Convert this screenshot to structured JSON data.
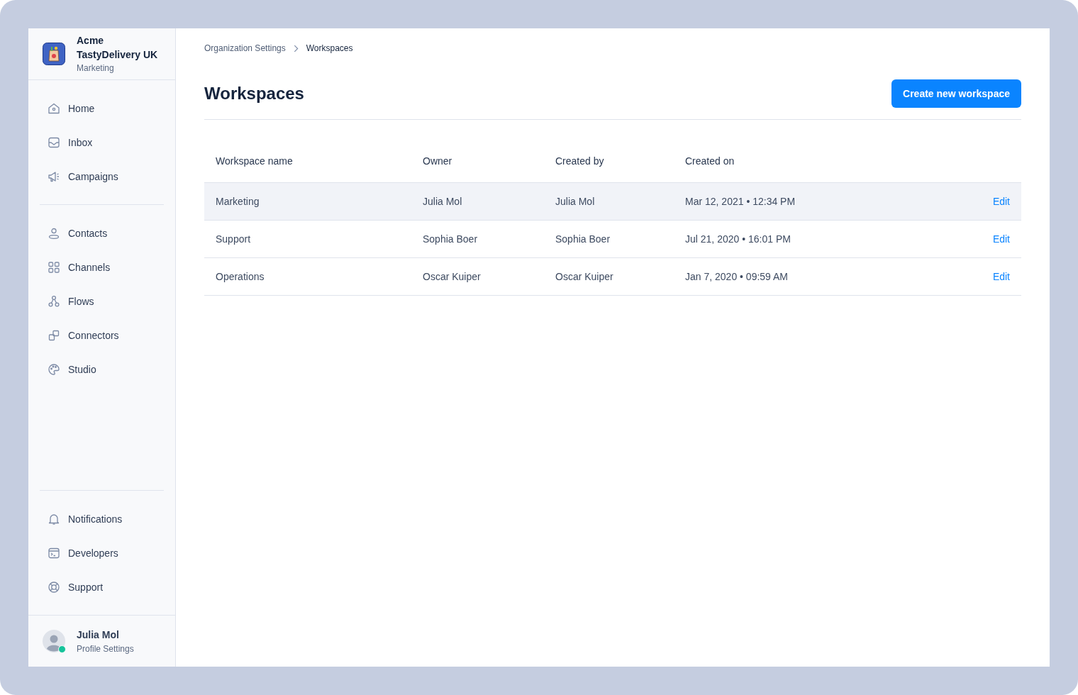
{
  "org": {
    "company": "Acme",
    "name": "TastyDelivery UK",
    "workspace": "Marketing"
  },
  "nav_groups": [
    {
      "items": [
        {
          "label": "Home",
          "selected": false
        },
        {
          "label": "Inbox",
          "selected": false
        },
        {
          "label": "Campaigns",
          "selected": false
        }
      ]
    },
    {
      "items": [
        {
          "label": "Contacts",
          "selected": false
        },
        {
          "label": "Channels",
          "selected": false
        },
        {
          "label": "Flows",
          "selected": false
        },
        {
          "label": "Connectors",
          "selected": false
        },
        {
          "label": "Studio",
          "selected": false
        }
      ]
    },
    {
      "items": [
        {
          "label": "Notifications",
          "selected": false
        },
        {
          "label": "Developers",
          "selected": false
        },
        {
          "label": "Support",
          "selected": false
        }
      ]
    }
  ],
  "profile": {
    "name": "Julia Mol",
    "subtitle": "Profile Settings",
    "online": true
  },
  "breadcrumb": [
    "Organization Settings",
    "Workspaces"
  ],
  "title": "Workspaces",
  "create_button": "Create new workspace",
  "table": {
    "columns": [
      "Workspace name",
      "Owner",
      "Created by",
      "Created on"
    ],
    "rows": [
      {
        "cells": [
          "Marketing",
          "Julia Mol",
          "Julia Mol",
          "Mar 12, 2021 • 12:34 PM"
        ],
        "action": "Edit",
        "selected": true
      },
      {
        "cells": [
          "Support",
          "Sophia Boer",
          "Sophia Boer",
          "Jul 21, 2020 • 16:01 PM"
        ],
        "action": "Edit",
        "selected": false
      },
      {
        "cells": [
          "Operations",
          "Oscar Kuiper",
          "Oscar Kuiper",
          "Jan 7, 2020 • 09:59 AM"
        ],
        "action": "Edit",
        "selected": false
      }
    ]
  }
}
